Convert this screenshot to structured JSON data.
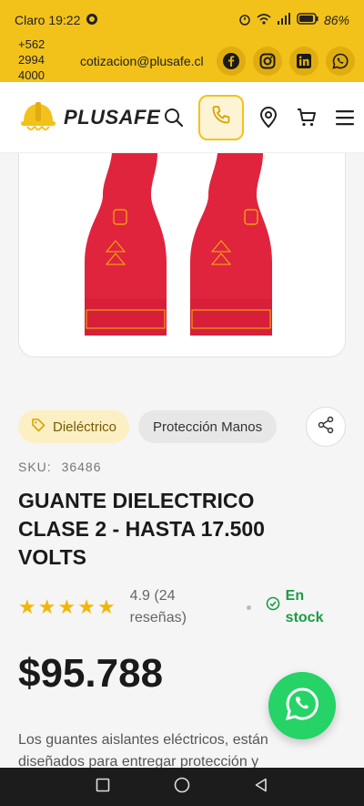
{
  "status_bar": {
    "carrier_time": "Claro 19:22",
    "battery": "86%"
  },
  "topbar": {
    "phone_line1": "+562",
    "phone_line2": "2994",
    "phone_line3": "4000",
    "email": "cotizacion@plusafe.cl",
    "social": [
      "facebook-icon",
      "instagram-icon",
      "linkedin-icon",
      "whatsapp-icon"
    ]
  },
  "header": {
    "logo_text": "PLUSAFE"
  },
  "product": {
    "tags": {
      "category": "Dieléctrico",
      "subcategory": "Protección Manos"
    },
    "sku_label": "SKU:",
    "sku_value": "36486",
    "title": "GUANTE DIELECTRICO CLASE 2 - HASTA 17.500 VOLTS",
    "rating_value": "4.9 (24 reseñas)",
    "stars": 5,
    "stock": "En stock",
    "price": "$95.788",
    "description": "Los guantes aislantes eléctricos, están diseñados para entregar protección y"
  },
  "colors": {
    "brand_yellow": "#f2c21b",
    "stock_green": "#1a9c45",
    "whatsapp_green": "#25d366"
  }
}
